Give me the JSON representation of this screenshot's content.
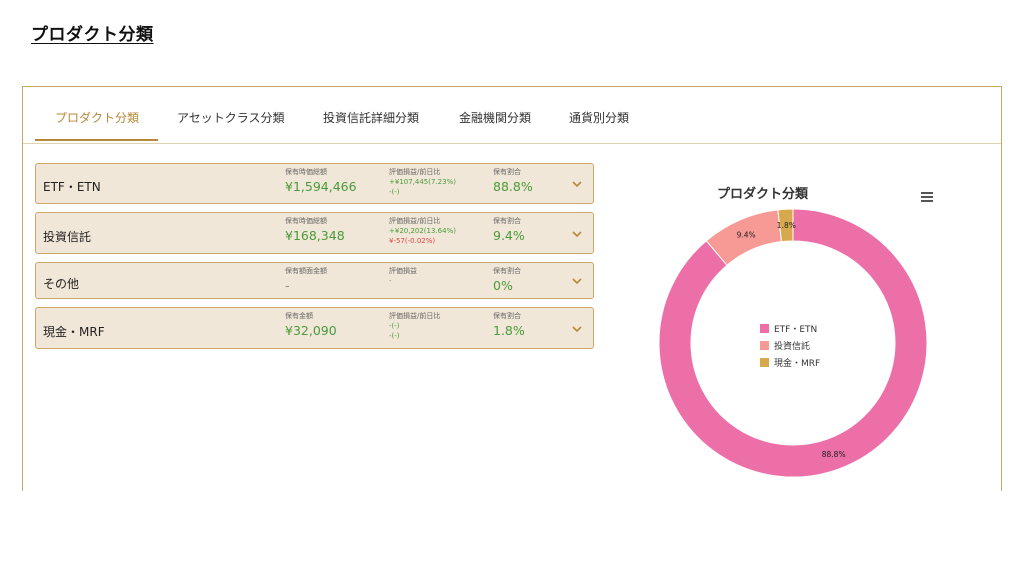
{
  "page": {
    "title": "プロダクト分類"
  },
  "tabs": [
    {
      "label": "プロダクト分類",
      "active": true
    },
    {
      "label": "アセットクラス分類",
      "active": false
    },
    {
      "label": "投資信託詳細分類",
      "active": false
    },
    {
      "label": "金融機関分類",
      "active": false
    },
    {
      "label": "通貨別分類",
      "active": false
    }
  ],
  "cards": [
    {
      "name": "ETF・ETN",
      "value_label": "保有時価総額",
      "value": "¥1,594,466",
      "pl_label": "評価損益/前日比",
      "pl_line1": "+¥107,445(7.23%)",
      "pl_line2": "-(-)",
      "ratio_label": "保有割合",
      "ratio": "88.8%"
    },
    {
      "name": "投資信託",
      "value_label": "保有時価総額",
      "value": "¥168,348",
      "pl_label": "評価損益/前日比",
      "pl_line1": "+¥20,202(13.64%)",
      "pl_line2": "¥-57(-0.02%)",
      "ratio_label": "保有割合",
      "ratio": "9.4%"
    },
    {
      "name": "その他",
      "value_label": "保有額面金額",
      "value": "-",
      "pl_label": "評価損益",
      "pl_line1": "-",
      "ratio_label": "保有割合",
      "ratio": "0%"
    },
    {
      "name": "現金・MRF",
      "value_label": "保有金額",
      "value": "¥32,090",
      "pl_label": "評価損益/前日比",
      "pl_line1": "-(-)",
      "pl_line2": "-(-)",
      "ratio_label": "保有割合",
      "ratio": "1.8%"
    }
  ],
  "colors": {
    "accent": "#b8893a",
    "positive": "#4a9a3a",
    "negative": "#e04545",
    "card_bg": "#f1e7d8"
  },
  "chart_data": {
    "type": "pie",
    "title": "プロダクト分類",
    "categories": [
      "ETF・ETN",
      "投資信託",
      "現金・MRF"
    ],
    "values": [
      88.8,
      9.4,
      1.8
    ],
    "data_labels": [
      "88.8%",
      "9.4%",
      "1.8%"
    ],
    "colors": [
      "#ec6fa8",
      "#f79a95",
      "#d8a94c"
    ],
    "donut": true,
    "legend_position": "center"
  }
}
